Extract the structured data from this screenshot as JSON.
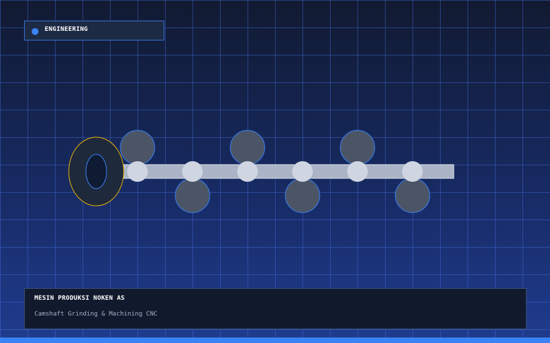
{
  "badge": {
    "label": "ENGINEERING",
    "dot_color": "#3b82f6"
  },
  "diagram": {
    "subject": "camshaft",
    "shaft_color": "#aab4c6",
    "journal_color": "#cfd6e2",
    "lobe_color": "#4b5566",
    "lobe_stroke": "#3b82f6",
    "flange_color": "#1e293b",
    "flange_stroke": "#eab308",
    "bore_color": "#0f1b33",
    "bore_stroke": "#3b82f6",
    "journal_count": 6,
    "lobes": [
      {
        "journal": 1,
        "side": "up"
      },
      {
        "journal": 2,
        "side": "down"
      },
      {
        "journal": 3,
        "side": "up"
      },
      {
        "journal": 4,
        "side": "down"
      },
      {
        "journal": 5,
        "side": "up"
      },
      {
        "journal": 6,
        "side": "down"
      }
    ]
  },
  "info": {
    "title": "MESIN PRODUKSI NOKEN AS",
    "subtitle": "Camshaft Grinding & Machining CNC"
  },
  "accent_color": "#3b82f6"
}
